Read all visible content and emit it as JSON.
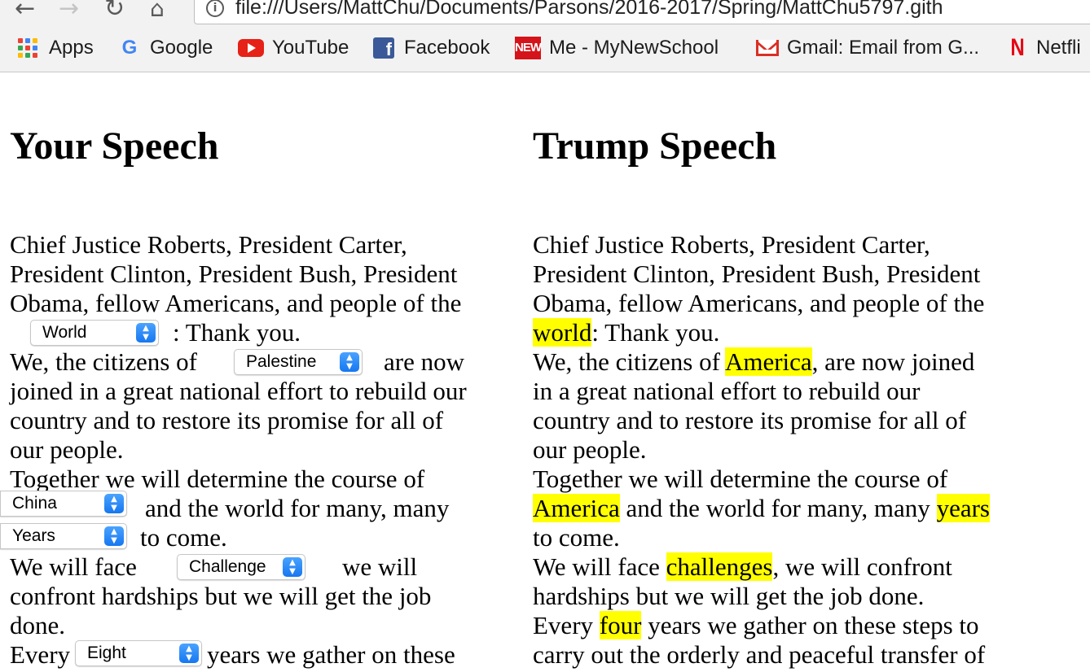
{
  "browser": {
    "url": "file:///Users/MattChu/Documents/Parsons/2016-2017/Spring/MattChu5797.gith",
    "bookmarks": [
      {
        "label": "Apps",
        "icon": "apps-icon"
      },
      {
        "label": "Google",
        "icon": "google-icon"
      },
      {
        "label": "YouTube",
        "icon": "youtube-icon"
      },
      {
        "label": "Facebook",
        "icon": "facebook-icon"
      },
      {
        "label": "Me - MyNewSchool",
        "icon": "newschool-icon"
      },
      {
        "label": "Gmail: Email from G...",
        "icon": "gmail-icon"
      },
      {
        "label": "Netfli",
        "icon": "netflix-icon"
      }
    ],
    "icon_text": {
      "google": "G",
      "facebook": "f",
      "newschool": "NEW",
      "netflix": "N"
    }
  },
  "your_speech": {
    "heading": "Your Speech",
    "t1": "Chief Justice Roberts, President Carter,",
    "t2": "President Clinton, President Bush, President",
    "t3": "Obama, fellow Americans, and people of the",
    "select1": "World",
    "t4": ": Thank you.",
    "t5a": "We, the citizens of",
    "select2": "Palestine",
    "t5b": "are now",
    "t6": "joined in a great national effort to rebuild our",
    "t7": "country and to restore its promise for all of",
    "t8": "our people.",
    "t9": "Together we will determine the course of",
    "select3": "China",
    "t10": "and the world for many, many",
    "select4": "Years",
    "t11": "to come.",
    "t12a": "We will face",
    "select5": "Challenge",
    "t12b": "we will",
    "t13": "confront hardships but we will get the job",
    "t14": "done.",
    "t15a": "Every",
    "select6": "Eight",
    "t15b": "years we gather on these"
  },
  "trump_speech": {
    "heading": "Trump Speech",
    "t1": "Chief Justice Roberts, President Carter,",
    "t2": "President Clinton, President Bush, President",
    "t3": "Obama, fellow Americans, and people of the",
    "h1": "world",
    "t4": ": Thank you.",
    "t5a": "We, the citizens of ",
    "h2": "America",
    "t5b": ", are now joined",
    "t6": "in a great national effort to rebuild our",
    "t7": "country and to restore its promise for all of",
    "t8": "our people.",
    "t9": "Together we will determine the course of",
    "h3": "America",
    "t10": " and the world for many, many ",
    "h4": "years",
    "t11": "to come.",
    "t12a": "We will face ",
    "h5": "challenges",
    "t12b": ", we will confront",
    "t13": "hardships but we will get the job done.",
    "t14a": "Every ",
    "h6": "four",
    "t14b": " years we gather on these steps to",
    "t15": "carry out the orderly and peaceful transfer of"
  },
  "colors": {
    "highlight": "#ffff00",
    "select_arrow": "#1677f0"
  }
}
